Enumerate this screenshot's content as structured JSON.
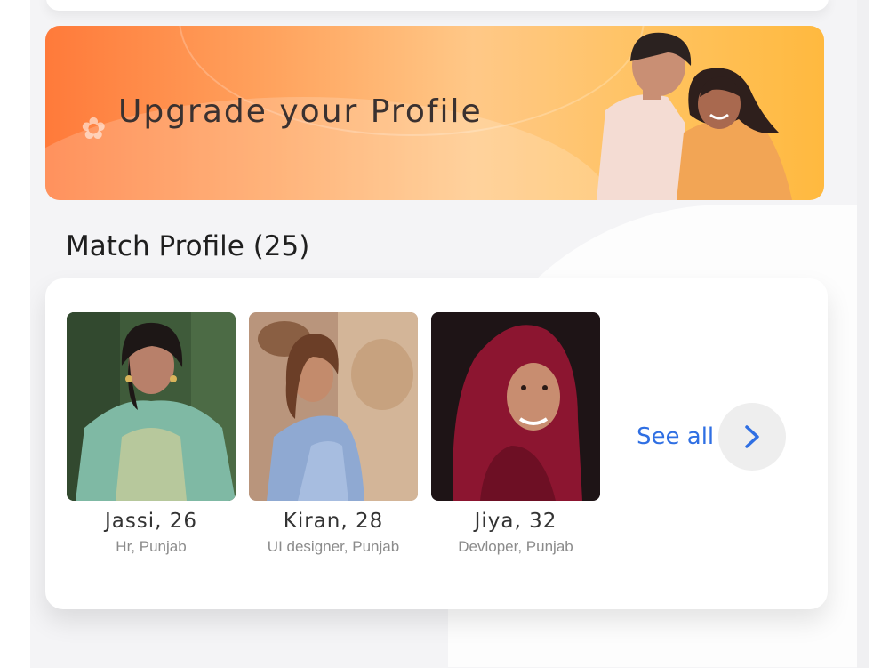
{
  "banner": {
    "title": "Upgrade your Profile"
  },
  "match_section": {
    "title": "Match Profile (25)",
    "profiles": [
      {
        "name": "Jassi, 26",
        "meta": "Hr, Punjab"
      },
      {
        "name": "Kiran, 28",
        "meta": "UI designer, Punjab"
      },
      {
        "name": "Jiya, 32",
        "meta": "Devloper, Punjab"
      }
    ],
    "see_all_label": "See all"
  },
  "colors": {
    "accent_blue": "#2f6fe3",
    "banner_orange": "#ff7a3a",
    "banner_yellow": "#ffc25d"
  },
  "icons": {
    "see_all": "chevron-right-icon"
  }
}
